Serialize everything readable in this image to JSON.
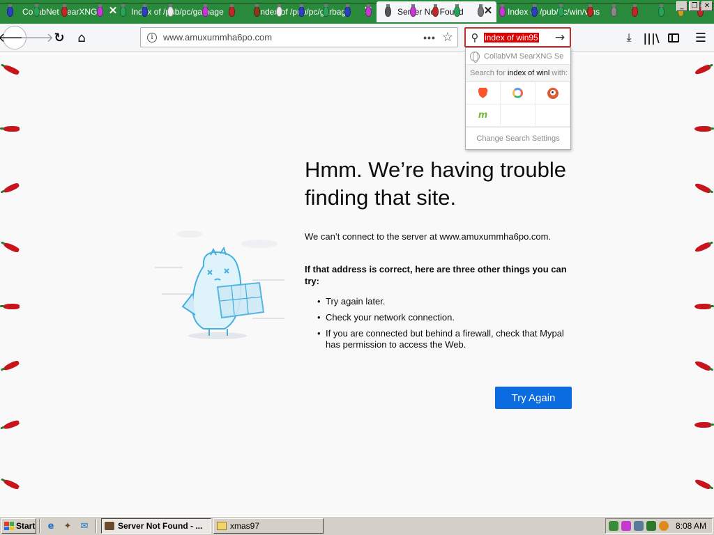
{
  "tabs": [
    {
      "label": "CollabNet SearXNG",
      "active": false
    },
    {
      "label": "Index of /pub/pc/garbage",
      "active": false
    },
    {
      "label": "Index of /pub/pc/garbage",
      "active": false
    },
    {
      "label": "Server Not Found",
      "active": true
    },
    {
      "label": "Index of /pub/pc/win/vms",
      "active": false
    }
  ],
  "window_controls": {
    "minimize": "_",
    "restore": "❐",
    "close": "✕"
  },
  "navbar": {
    "back_icon": "🡐",
    "forward_icon": "🡒",
    "reload_icon": "↻",
    "home_icon": "⌂",
    "url": "www.amuxummha6po.com",
    "info_icon": "i",
    "page_actions_icon": "•••",
    "bookmark_icon": "☆",
    "search_query": "index of win95",
    "search_icon": "⚲",
    "search_go_icon": "→",
    "downloads_icon": "⤓",
    "library_icon": "|||\\",
    "menu_icon": "☰"
  },
  "search_popup": {
    "suggestion": "CollabVM SearXNG Se",
    "search_for_prefix": "Search for",
    "search_for_query": "index of winl",
    "search_for_suffix": "with:",
    "engines": [
      "brave",
      "qwant",
      "duckduckgo",
      "mojeek"
    ],
    "settings": "Change Search Settings"
  },
  "error_page": {
    "title": "Hmm. We’re having trouble finding that site.",
    "description": "We can’t connect to the server at www.amuxummha6po.com.",
    "subtitle": "If that address is correct, here are three other things you can try:",
    "suggestions": [
      "Try again later.",
      "Check your network connection.",
      "If you are connected but behind a firewall, check that Mypal has permission to access the Web."
    ],
    "try_again": "Try Again"
  },
  "taskbar": {
    "start": "Start",
    "tasks": [
      {
        "label": "Server Not Found - ...",
        "active": true
      },
      {
        "label": "xmas97",
        "active": false
      }
    ],
    "clock": "8:08 AM"
  },
  "colors": {
    "tab_strip": "#2a8a3c",
    "accent_button": "#0a6ce0",
    "search_highlight": "#dd0000",
    "pepper": "#c8141c"
  }
}
